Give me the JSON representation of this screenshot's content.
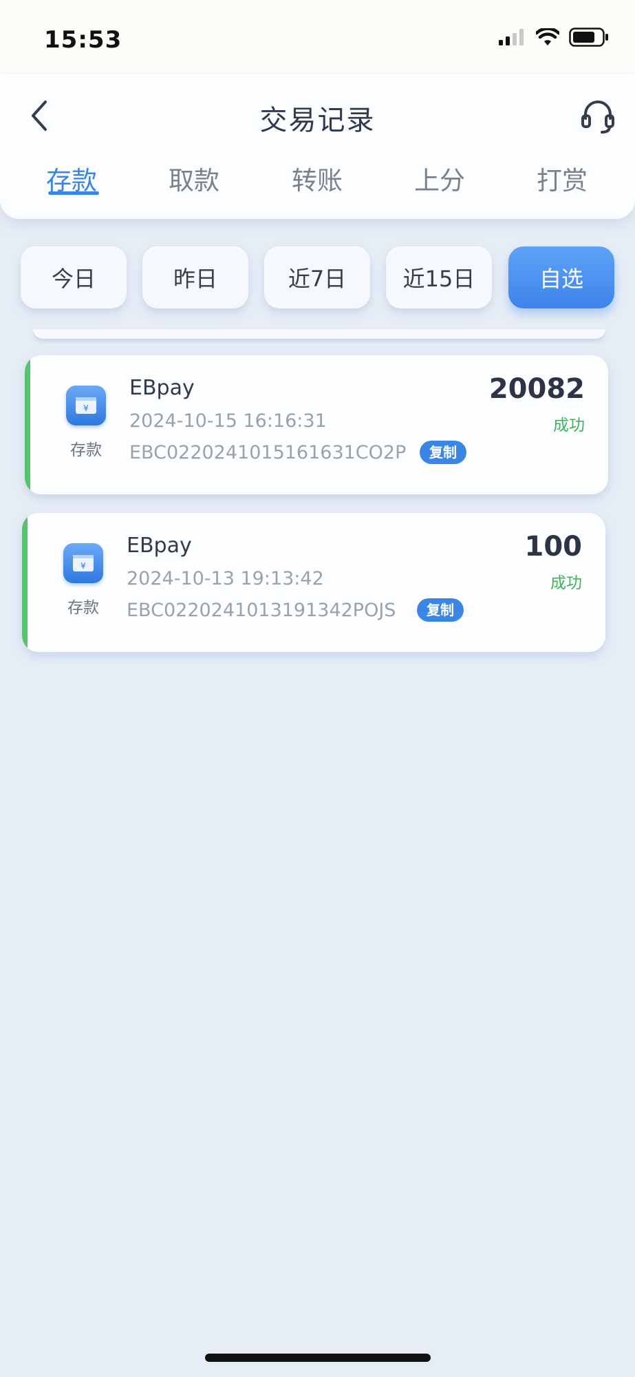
{
  "status_bar": {
    "time": "15:53"
  },
  "header": {
    "title": "交易记录"
  },
  "tabs": [
    {
      "label": "存款",
      "active": true
    },
    {
      "label": "取款",
      "active": false
    },
    {
      "label": "转账",
      "active": false
    },
    {
      "label": "上分",
      "active": false
    },
    {
      "label": "打赏",
      "active": false
    }
  ],
  "filters": [
    {
      "label": "今日",
      "active": false
    },
    {
      "label": "昨日",
      "active": false
    },
    {
      "label": "近7日",
      "active": false
    },
    {
      "label": "近15日",
      "active": false
    },
    {
      "label": "自选",
      "active": true
    }
  ],
  "records": [
    {
      "type": "存款",
      "channel": "EBpay",
      "time": "2024-10-15 16:16:31",
      "order_no": "EBC0220241015161631CO2P",
      "copy_label": "复制",
      "amount": "20082",
      "status": "成功"
    },
    {
      "type": "存款",
      "channel": "EBpay",
      "time": "2024-10-13 19:13:42",
      "order_no": "EBC0220241013191342POJS",
      "copy_label": "复制",
      "amount": "100",
      "status": "成功"
    }
  ],
  "colors": {
    "accent": "#3a86e6",
    "success": "#3fb35a",
    "record_stripe": "#56c46d",
    "background": "#e6edf6"
  },
  "icons": {
    "back": "chevron-left-icon",
    "service": "headset-icon",
    "record": "wallet-yen-icon"
  }
}
